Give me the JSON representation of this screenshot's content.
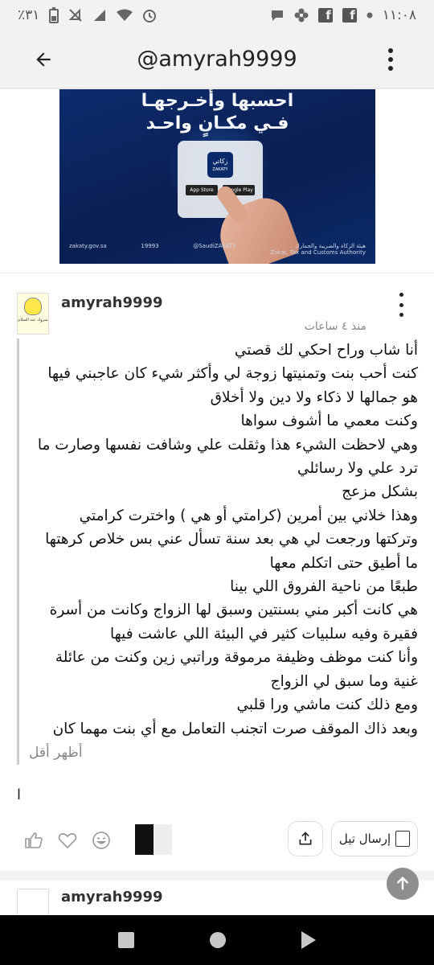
{
  "status_bar": {
    "time": "١١:٠٨",
    "battery": "٪٣١",
    "icons": [
      "dot-icon",
      "facebook-icon",
      "facebook-icon",
      "flower-icon",
      "chat-bubble-icon",
      "alarm-icon",
      "wifi-icon",
      "signal-icon",
      "mute-icon",
      "battery-icon"
    ]
  },
  "app_bar": {
    "title": "@amyrah9999",
    "back_icon": "arrow-back-icon",
    "menu_icon": "more-vert-icon"
  },
  "banner": {
    "headline_1": "احسبها وأخـرجهـا",
    "headline_2": "فـي مكـانٍ واحـد",
    "app_name": "زكاتي",
    "app_name_en": "ZAKATY",
    "store_1": "App Store",
    "store_2": "Google Play",
    "footer_site": "zakaty.gov.sa",
    "footer_phone": "19993",
    "footer_handle": "@SaudiZAKATY",
    "authority_ar": "هيئة الزكاة والضريبة والجمارك",
    "authority_en": "Zakat, Tax and Customs Authority"
  },
  "post": {
    "username": "amyrah9999",
    "time": "منذ ٤ ساعات",
    "avatar_caption": "مبروك عبد السلام",
    "lines": [
      "أنا شاب وراح احكي لك قصتي",
      "كنت أحب بنت وتمنيتها زوجة لي وأكثر شيء كان عاجبني فيها",
      "هو جمالها لا ذكاء ولا دين ولا أخلاق",
      "وكنت معمي ما أشوف سواها",
      "وهي لاحظت الشيء هذا وثقلت علي وشافت نفسها وصارت ما",
      "ترد علي ولا رسائلي",
      "بشكل مزعج",
      "وهذا خلاني بين أمرين (كرامتي أو هي ) واخترت كرامتي",
      "وتركتها ورجعت لي هي بعد سنة تسأل عني بس خلاص كرهتها",
      "ما أطيق حتى اتكلم معها",
      "طبعًا من ناحية الفروق اللي بينا",
      "هي كانت أكبر مني بسنتين وسبق لها الزواج وكانت من أسرة",
      "فقيرة وفيه سلبيات كثير في البيئة اللي عاشت فيها",
      "وأنا كنت موظف وظيفة مرموقة وراتبي زين وكنت من عائلة",
      "غنية وما سبق لي الزواج",
      "ومع ذلك كنت ماشي ورا قلبي",
      "وبعد ذاك الموقف صرت اتجنب التعامل مع أي بنت مهما كان"
    ],
    "show_less": "أظهر أقل",
    "stray_char": "ا",
    "send_label": "إرسال تيل"
  },
  "actions": {
    "like_icon": "thumb-up-icon",
    "heart_icon": "heart-icon",
    "laugh_icon": "laugh-emoji-icon",
    "share_icon": "share-icon",
    "send_icon": "send-tell-icon"
  },
  "next_post": {
    "username": "amyrah9999"
  },
  "nav": {
    "recent_icon": "recent-apps-icon",
    "home_icon": "home-icon",
    "back_icon": "back-triangle-icon"
  },
  "colors": {
    "banner_bg": "#0d2c6e",
    "status_bg": "#f2f2f2",
    "fab_bg": "#8e8e8e"
  }
}
